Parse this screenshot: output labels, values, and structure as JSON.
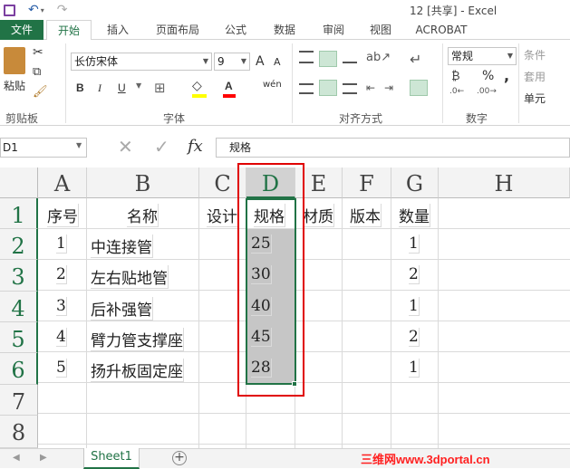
{
  "window": {
    "title": "12  [共享] - Excel"
  },
  "tabs": [
    "文件",
    "开始",
    "插入",
    "页面布局",
    "公式",
    "数据",
    "审阅",
    "视图",
    "ACROBAT"
  ],
  "ribbon": {
    "clipboard": {
      "label": "剪贴板",
      "paste": "粘贴"
    },
    "font": {
      "label": "字体",
      "name": "长仿宋体",
      "size": "9",
      "bold": "B",
      "italic": "I",
      "underline": "U",
      "grow": "A",
      "shrink": "A",
      "phonetic": "wén"
    },
    "alignment": {
      "label": "对齐方式"
    },
    "number": {
      "label": "数字",
      "format": "常规",
      "percent": "%",
      "comma": ","
    },
    "styles": {
      "conditional": "条件",
      "table": "套用",
      "cell": "单元"
    }
  },
  "formula_bar": {
    "name_box": "D1",
    "fx": "fx",
    "content": "规格"
  },
  "columns": [
    "A",
    "B",
    "C",
    "D",
    "E",
    "F",
    "G",
    "H"
  ],
  "rows": [
    "1",
    "2",
    "3",
    "4",
    "5",
    "6",
    "7",
    "8"
  ],
  "headers": [
    "序号",
    "名称",
    "设计",
    "规格",
    "材质",
    "版本",
    "数量"
  ],
  "data": [
    {
      "a": "1",
      "b": "中连接管",
      "d": "25",
      "g": "1"
    },
    {
      "a": "2",
      "b": "左右贴地管",
      "d": "30",
      "g": "2"
    },
    {
      "a": "3",
      "b": "后补强管",
      "d": "40",
      "g": "1"
    },
    {
      "a": "4",
      "b": "臂力管支撑座",
      "d": "45",
      "g": "2"
    },
    {
      "a": "5",
      "b": "扬升板固定座",
      "d": "28",
      "g": "1"
    }
  ],
  "sheet": {
    "name": "Sheet1",
    "add": "+"
  },
  "watermark": "三维网www.3dportal.cn",
  "colors": {
    "accent": "#217346",
    "highlight": "#e00000"
  }
}
